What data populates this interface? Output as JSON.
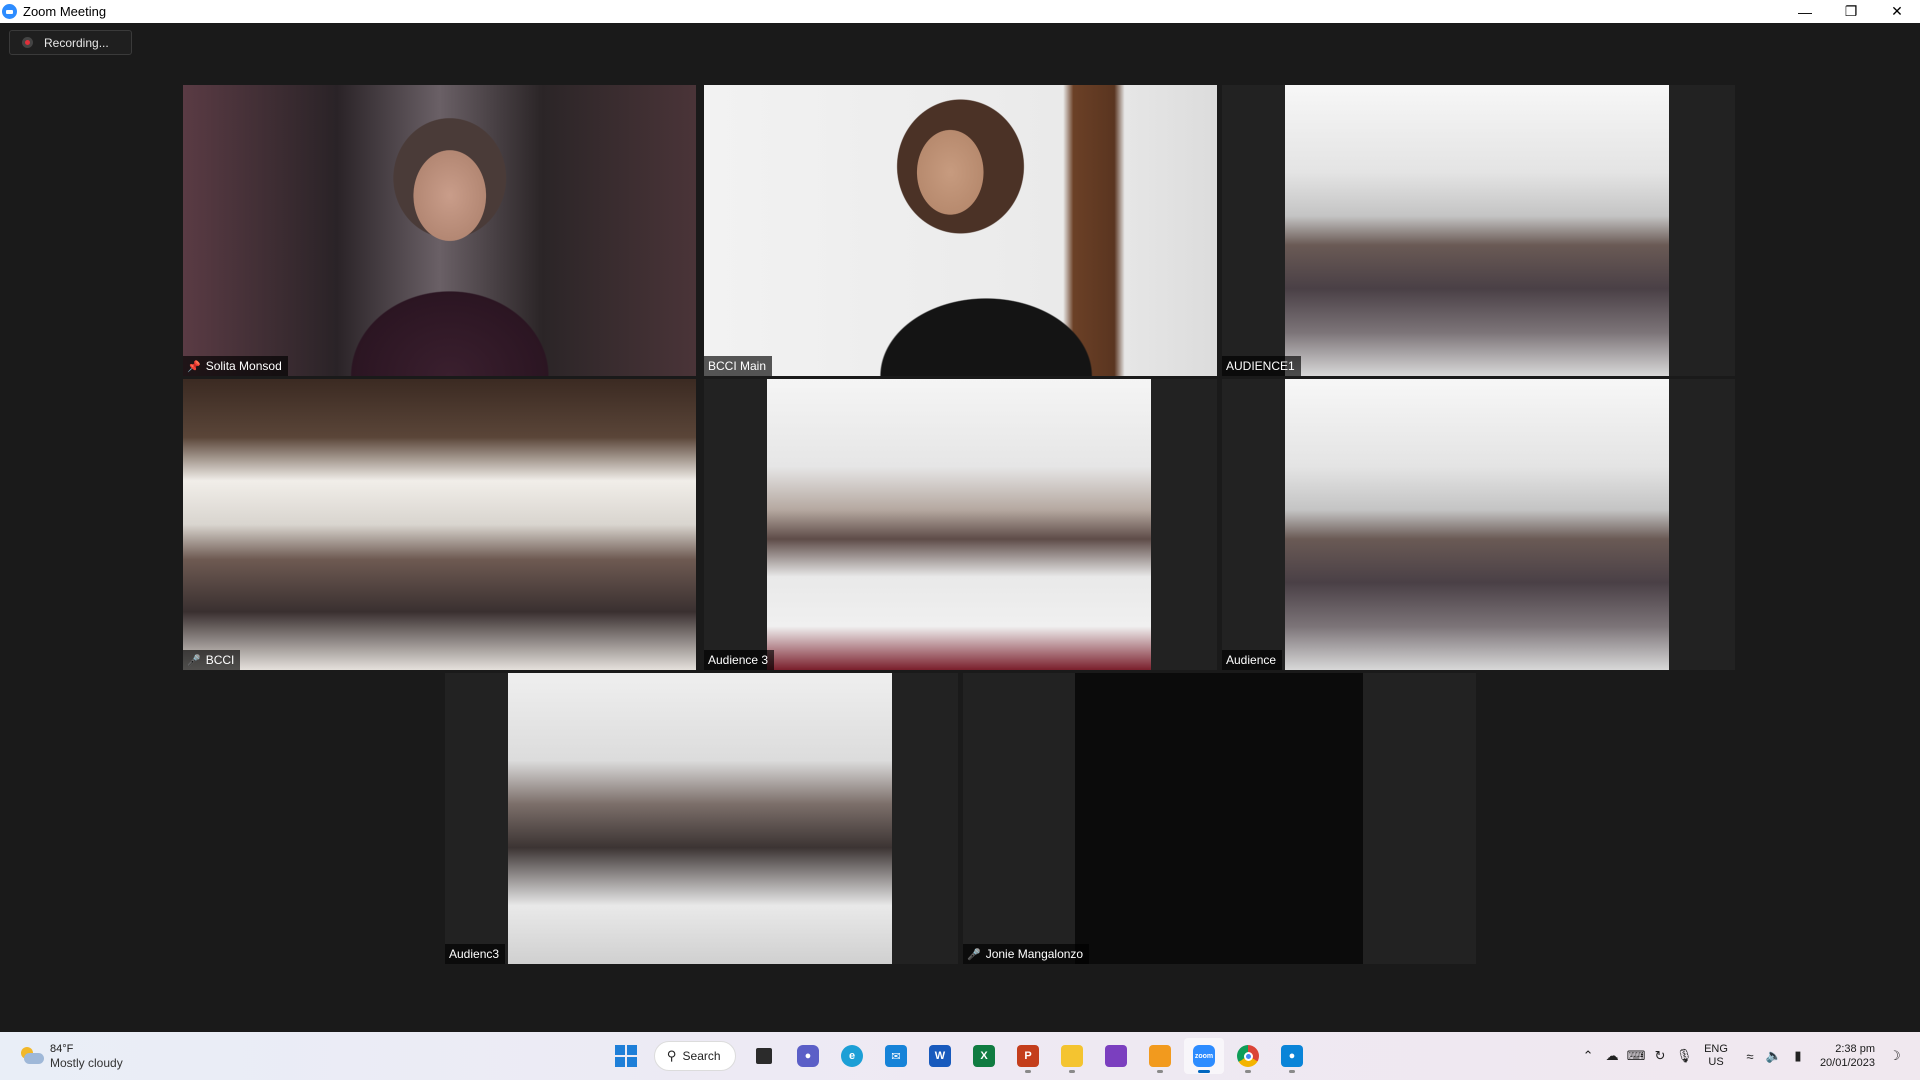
{
  "window": {
    "title": "Zoom Meeting",
    "controls": {
      "minimize": "—",
      "restore": "❐",
      "close": "✕"
    }
  },
  "meeting": {
    "recording_label": "Recording...",
    "tiles": [
      {
        "name": "Solita Monsod",
        "icon": "pin-icon",
        "active": true
      },
      {
        "name": "BCCI Main",
        "icon": "",
        "active": false
      },
      {
        "name": "AUDIENCE1",
        "icon": "",
        "active": false
      },
      {
        "name": "BCCI",
        "icon": "mic-off-icon",
        "active": false
      },
      {
        "name": "Audience 3",
        "icon": "",
        "active": false
      },
      {
        "name": "Audience",
        "icon": "",
        "active": false
      },
      {
        "name": "Audienc3",
        "icon": "",
        "active": false
      },
      {
        "name": "Jonie Mangalonzo",
        "icon": "mic-off-icon",
        "active": false
      }
    ],
    "colors": {
      "active_speaker_border": "#d8ef5a",
      "mic_off": "#e03a3a"
    }
  },
  "taskbar": {
    "weather": {
      "temp": "84°F",
      "condition": "Mostly cloudy"
    },
    "search_label": "Search",
    "apps": [
      "start",
      "search",
      "task-view",
      "teams-chat",
      "edge",
      "mail",
      "word",
      "excel",
      "powerpoint",
      "file-explorer",
      "clipchamp",
      "slides",
      "zoom",
      "chrome",
      "snipping-tool"
    ],
    "language": {
      "lang": "ENG",
      "region": "US"
    },
    "clock": {
      "time": "2:38 pm",
      "date": "20/01/2023"
    }
  }
}
